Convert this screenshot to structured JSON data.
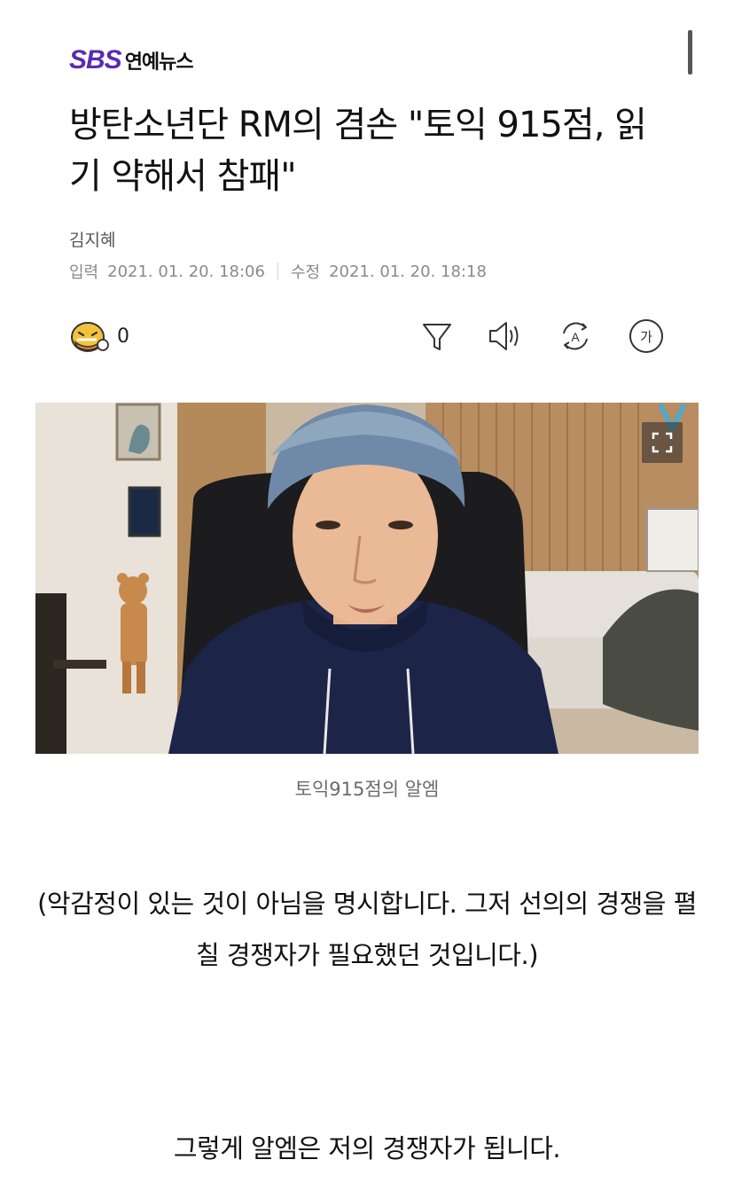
{
  "header": {
    "logo_brand": "SBS",
    "logo_section": "연예뉴스"
  },
  "article": {
    "title": "방탄소년단 RM의 겸손 \"토익 915점, 읽기 약해서 참패\"",
    "author": "김지혜",
    "input_label": "입력",
    "input_date": "2021. 01. 20. 18:06",
    "modified_label": "수정",
    "modified_date": "2021. 01. 20. 18:18",
    "reaction_count": "0",
    "photo_caption": "토익915점의 알엠",
    "paragraph_1": "(악감정이 있는 것이 아님을 명시합니다. 그저 선의의 경쟁을 펼칠 경쟁자가 필요했던 것입니다.)",
    "paragraph_2": "그렇게 알엠은 저의 경쟁자가 됩니다."
  },
  "toolbar": {
    "icons": [
      "reaction-icon",
      "filter-icon",
      "speaker-icon",
      "translate-icon",
      "font-size-icon"
    ],
    "font_size_glyph": "가",
    "translate_glyph": "A"
  },
  "colors": {
    "brand": "#5a2bb0",
    "text": "#111111",
    "meta": "#8a8a8a"
  }
}
